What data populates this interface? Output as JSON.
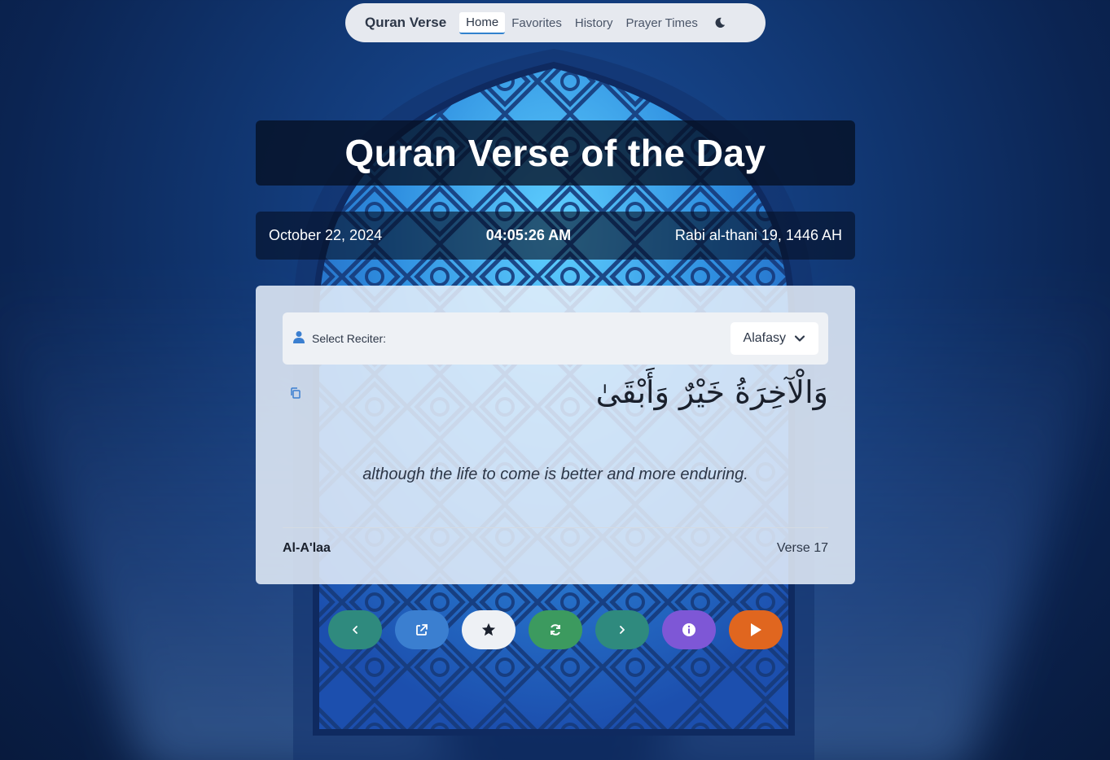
{
  "nav": {
    "brand": "Quran Verse",
    "links": [
      "Home",
      "Favorites",
      "History",
      "Prayer Times"
    ],
    "active": "Home",
    "theme_icon": "moon-icon"
  },
  "title": "Quran Verse of the Day",
  "datebar": {
    "gregorian": "October 22, 2024",
    "time": "04:05:26 AM",
    "hijri": "Rabi al-thani 19, 1446 AH"
  },
  "reciter": {
    "label": "Select Reciter:",
    "selected": "Alafasy",
    "icon": "user-icon"
  },
  "verse": {
    "arabic": "وَالْآخِرَةُ خَيْرٌ وَأَبْقَىٰ",
    "translation": "although the life to come is better and more enduring.",
    "surah": "Al-A'laa",
    "verse_label": "Verse 17"
  },
  "actions": [
    {
      "icon": "chevron-left-icon",
      "color": "#2f8a7e"
    },
    {
      "icon": "external-link-icon",
      "color": "#3b7fd0"
    },
    {
      "icon": "star-icon",
      "color": "#eef1f5"
    },
    {
      "icon": "refresh-icon",
      "color": "#3c9a5f"
    },
    {
      "icon": "chevron-right-icon",
      "color": "#2f8a7e"
    },
    {
      "icon": "info-icon",
      "color": "#7e57d6"
    },
    {
      "icon": "play-icon",
      "color": "#e0661f"
    }
  ],
  "colors": {
    "accent": "#3182ce",
    "card": "#e8f0fa",
    "title_bg": "#050f23"
  }
}
